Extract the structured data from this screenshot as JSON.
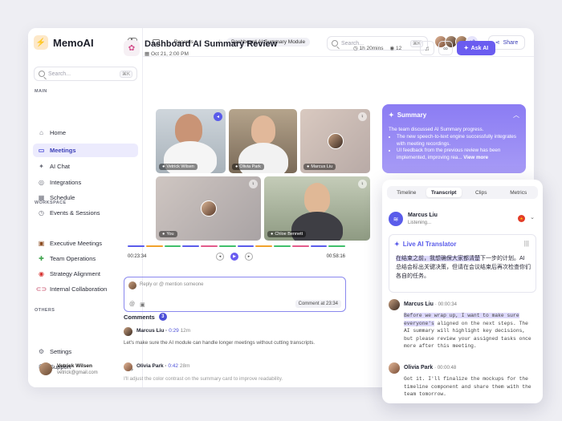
{
  "app": {
    "name": "MemoAI"
  },
  "sidebar": {
    "search_placeholder": "Search...",
    "search_shortcut": "⌘K",
    "main_label": "MAIN",
    "main_items": [
      {
        "label": "Home",
        "icon": "home-icon"
      },
      {
        "label": "Meetings",
        "icon": "video-icon",
        "active": true
      },
      {
        "label": "AI Chat",
        "icon": "sparkle-icon"
      },
      {
        "label": "Integrations",
        "icon": "integrations-icon"
      },
      {
        "label": "Schedule",
        "icon": "calendar-icon"
      },
      {
        "label": "Events & Sessions",
        "icon": "events-icon"
      }
    ],
    "workspace_label": "WORKSPACE",
    "workspace_items": [
      {
        "label": "Executive Meetings",
        "icon": "briefcase-icon"
      },
      {
        "label": "Team Operations",
        "icon": "puzzle-icon"
      },
      {
        "label": "Strategy Alignment",
        "icon": "target-icon"
      },
      {
        "label": "Internal Collaboration",
        "icon": "link-icon"
      }
    ],
    "others_label": "OTHERS",
    "others_items": [
      {
        "label": "Settings",
        "icon": "gear-icon"
      },
      {
        "label": "Support",
        "icon": "headset-icon"
      }
    ],
    "user": {
      "name": "Vetrick Wilsen",
      "email": "vetrick@gmail.com"
    }
  },
  "topbar": {
    "breadcrumbs": [
      "Records",
      "...",
      "Dashboard AI Summary Module"
    ],
    "search_placeholder": "Search...",
    "search_shortcut": "⌘K",
    "avatars_more": "+2",
    "share_label": "Share"
  },
  "page": {
    "title": "Dashboard AI Summary Review",
    "date": "Oct 21, 2:00 PM",
    "duration": "1h 20mins",
    "views": "12",
    "ask_ai_label": "Ask AI"
  },
  "participants": [
    {
      "name": "Vetrick Wilsen"
    },
    {
      "name": "Olivia Park"
    },
    {
      "name": "Marcus Liu"
    },
    {
      "name": "You"
    },
    {
      "name": "Chloe Bennett"
    }
  ],
  "player": {
    "current": "00:23:34",
    "end": "00:58:16",
    "segment_colors": [
      "#5a5cea",
      "#f1a22b",
      "#3fbf6b",
      "#5a5cea",
      "#e25a8a",
      "#3fbf6b",
      "#5a5cea",
      "#f1a22b",
      "#3fbf6b",
      "#e25a8a",
      "#5a5cea",
      "#3fbf6b"
    ]
  },
  "reply": {
    "placeholder": "Reply or @ mention someone",
    "comment_at": "Comment at 23:34"
  },
  "comments": {
    "title": "Comments",
    "count": "3",
    "items": [
      {
        "name": "Marcus Liu",
        "time": "0:29",
        "ago": "12m",
        "text": "Let's make sure the AI module can handle longer meetings without cutting transcripts."
      },
      {
        "name": "Olivia Park",
        "time": "0:42",
        "ago": "28m",
        "text": "I'll adjust the color contrast on the summary card to improve readability."
      }
    ]
  },
  "summary": {
    "title": "Summary",
    "intro": "The team discussed AI Summary progress.",
    "bullets": [
      "The new speech-to-text engine successfully integrates with meeting recordings.",
      "UI feedback from the previous review has been implemented, improving rea..."
    ],
    "view_more": "View more"
  },
  "panel": {
    "tabs": [
      "Timeline",
      "Transcript",
      "Clips",
      "Metrics"
    ],
    "active_tab": "Transcript",
    "live_speaker": {
      "name": "Marcus Liu",
      "status": "Listening..."
    },
    "translator": {
      "title": "Live AI Translator",
      "highlight": "在结束之前，我想确保大家都清楚",
      "rest": "下一步的计划。AI 总结会标出关键决策，但请在会议结束后再次检查你们各自的任务。"
    },
    "transcript": [
      {
        "name": "Marcus Liu",
        "time": "00:00:34",
        "highlight": "Before we wrap up, I want to make sure everyone's",
        "text": " aligned on the next steps. The AI summary will highlight key decisions, but please review your assigned tasks once more after this meeting."
      },
      {
        "name": "Olivia Park",
        "time": "00:00:48",
        "highlight": "",
        "text": "Got it. I'll finalize the mockups for the timeline component and share them with the team tomorrow."
      }
    ]
  }
}
